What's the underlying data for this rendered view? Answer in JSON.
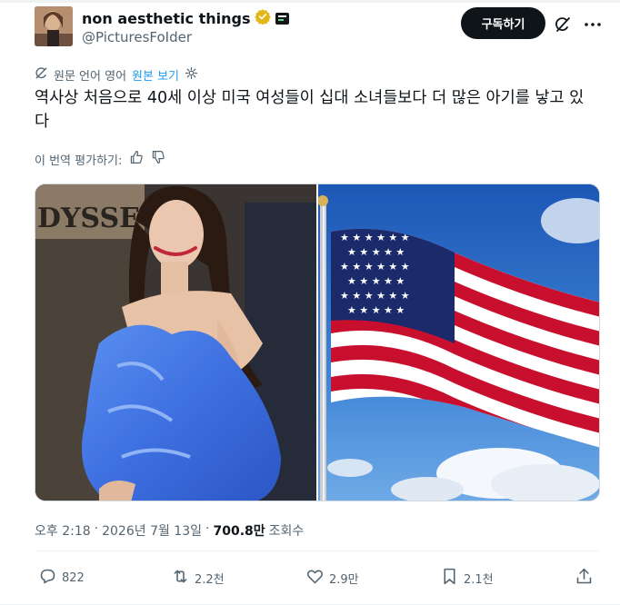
{
  "header": {
    "display_name": "non aesthetic things",
    "handle": "@PicturesFoIder",
    "subscribe_label": "구독하기",
    "icons": [
      "verified-badge-icon",
      "affiliate-badge-icon",
      "grok-icon",
      "more-icon"
    ]
  },
  "translation": {
    "source_note": "원문 언어 영어",
    "show_original": "원본 보기",
    "text": "역사상 처음으로 40세 이상 미국 여성들이 십대 소녀들보다 더 많은 아기를 낳고 있다",
    "rate_label": "이 번역 평가하기:"
  },
  "media": {
    "left_image": "pregnant-woman-blue-dress-photo",
    "left_sign_text": "DYSSE",
    "right_image": "american-flag-photo"
  },
  "meta": {
    "time": "오후 2:18",
    "separator": "·",
    "date": "2026년 7월 13일",
    "separator2": "·",
    "views_count": "700.8만",
    "views_label": "조회수"
  },
  "actions": {
    "replies": "822",
    "reposts": "2.2천",
    "likes": "2.9만",
    "bookmarks": "2.1천"
  },
  "colors": {
    "accent": "#1d9bf0",
    "text": "#0f1419",
    "secondary": "#536471",
    "verified_gold": "#e2b719"
  }
}
